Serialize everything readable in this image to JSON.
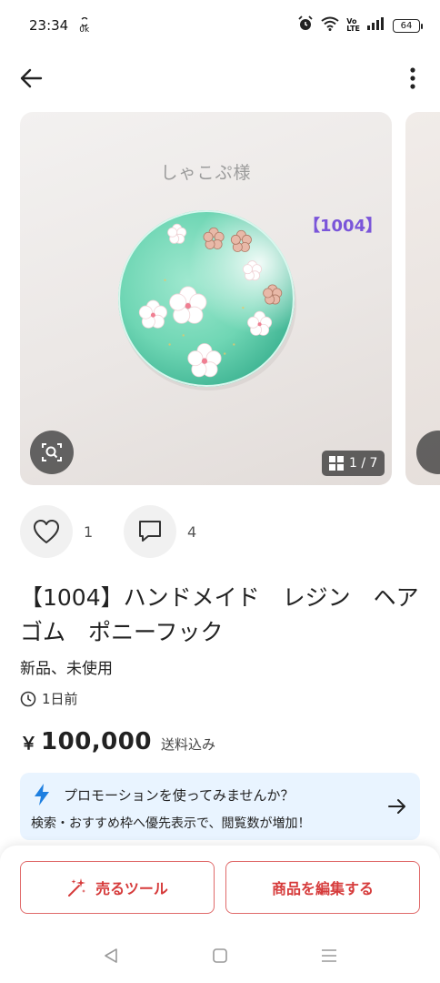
{
  "status_bar": {
    "time": "23:34",
    "data_indicator": "0k",
    "battery": "64"
  },
  "app_bar": {
    "back_icon": "arrow-left-icon",
    "menu_icon": "more-vertical-icon"
  },
  "carousel": {
    "watermark": "しゃこぷ様",
    "code_label": "【1004】",
    "page_counter": "1 / 7",
    "current_index": 1,
    "total": 7
  },
  "reactions": {
    "likes": "1",
    "comments": "4"
  },
  "product": {
    "title": "【1004】ハンドメイド　レジン　ヘアゴム　ポニーフック",
    "condition": "新品、未使用",
    "listed": "1日前",
    "price_symbol": "￥",
    "price": "100,000",
    "shipping_note": "送料込み"
  },
  "promotion": {
    "title": "プロモーションを使ってみませんか？",
    "description": "検索・おすすめ枠へ優先表示で、閲覧数が増加！"
  },
  "actions": {
    "sell_tools": "売るツール",
    "edit_item": "商品を編集する"
  },
  "colors": {
    "accent_red": "#d63b3b",
    "promo_bg": "#e9f4ff",
    "promo_icon": "#1e7fe0",
    "label_purple": "#7a55d9",
    "resin_green": "#6fd6b4"
  }
}
